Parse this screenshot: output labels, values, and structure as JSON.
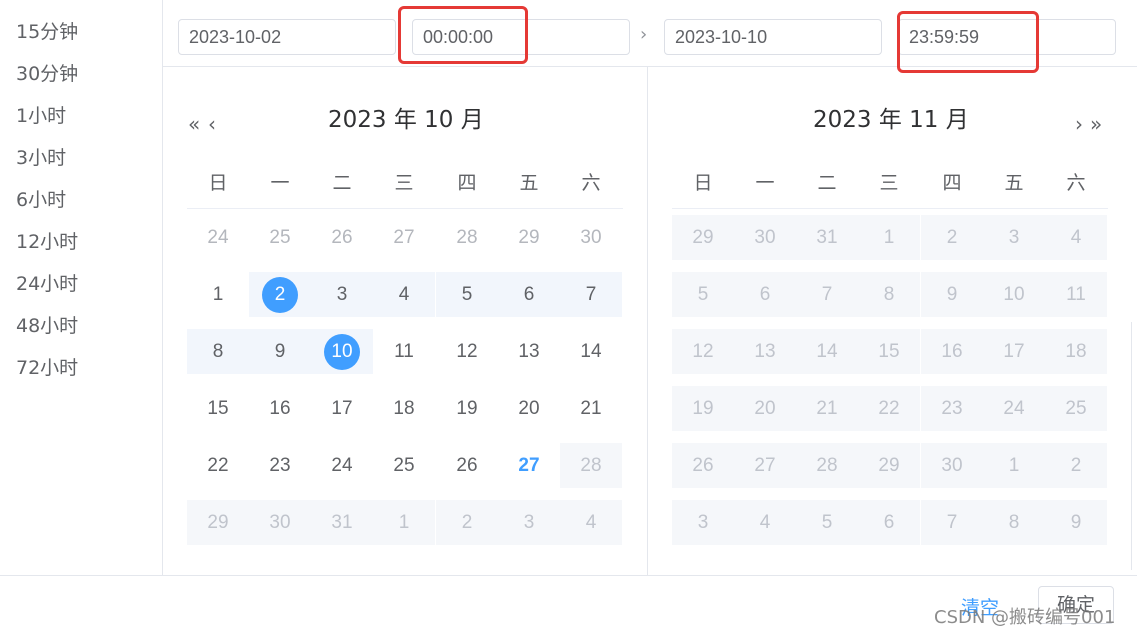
{
  "shortcuts": [
    "15分钟",
    "30分钟",
    "1小时",
    "3小时",
    "6小时",
    "12小时",
    "24小时",
    "48小时",
    "72小时"
  ],
  "header": {
    "start_date": "2023-10-02",
    "start_time": "00:00:00",
    "separator": "›",
    "end_date": "2023-10-10",
    "end_time": "23:59:59"
  },
  "left_panel": {
    "title": "2023 年 10 月",
    "prev_year": "«",
    "prev_month": "‹",
    "weekdays": [
      "日",
      "一",
      "二",
      "三",
      "四",
      "五",
      "六"
    ],
    "rows": [
      [
        {
          "d": "24",
          "s": "muted"
        },
        {
          "d": "25",
          "s": "muted"
        },
        {
          "d": "26",
          "s": "muted"
        },
        {
          "d": "27",
          "s": "muted"
        },
        {
          "d": "28",
          "s": "muted"
        },
        {
          "d": "29",
          "s": "muted"
        },
        {
          "d": "30",
          "s": "muted"
        }
      ],
      [
        {
          "d": "1",
          "s": ""
        },
        {
          "d": "2",
          "s": "start"
        },
        {
          "d": "3",
          "s": "range"
        },
        {
          "d": "4",
          "s": "range"
        },
        {
          "d": "5",
          "s": "range"
        },
        {
          "d": "6",
          "s": "range"
        },
        {
          "d": "7",
          "s": "range"
        }
      ],
      [
        {
          "d": "8",
          "s": "range"
        },
        {
          "d": "9",
          "s": "range"
        },
        {
          "d": "10",
          "s": "end"
        },
        {
          "d": "11",
          "s": ""
        },
        {
          "d": "12",
          "s": ""
        },
        {
          "d": "13",
          "s": ""
        },
        {
          "d": "14",
          "s": ""
        }
      ],
      [
        {
          "d": "15",
          "s": ""
        },
        {
          "d": "16",
          "s": ""
        },
        {
          "d": "17",
          "s": ""
        },
        {
          "d": "18",
          "s": ""
        },
        {
          "d": "19",
          "s": ""
        },
        {
          "d": "20",
          "s": ""
        },
        {
          "d": "21",
          "s": ""
        }
      ],
      [
        {
          "d": "22",
          "s": ""
        },
        {
          "d": "23",
          "s": ""
        },
        {
          "d": "24",
          "s": ""
        },
        {
          "d": "25",
          "s": ""
        },
        {
          "d": "26",
          "s": ""
        },
        {
          "d": "27",
          "s": "today"
        },
        {
          "d": "28",
          "s": "disabled"
        }
      ],
      [
        {
          "d": "29",
          "s": "disabled"
        },
        {
          "d": "30",
          "s": "disabled"
        },
        {
          "d": "31",
          "s": "disabled"
        },
        {
          "d": "1",
          "s": "disabled"
        },
        {
          "d": "2",
          "s": "disabled"
        },
        {
          "d": "3",
          "s": "disabled"
        },
        {
          "d": "4",
          "s": "disabled"
        }
      ]
    ]
  },
  "right_panel": {
    "title": "2023 年 11 月",
    "next_month": "›",
    "next_year": "»",
    "weekdays": [
      "日",
      "一",
      "二",
      "三",
      "四",
      "五",
      "六"
    ],
    "rows": [
      [
        {
          "d": "29",
          "s": "disabled"
        },
        {
          "d": "30",
          "s": "disabled"
        },
        {
          "d": "31",
          "s": "disabled"
        },
        {
          "d": "1",
          "s": "disabled"
        },
        {
          "d": "2",
          "s": "disabled"
        },
        {
          "d": "3",
          "s": "disabled"
        },
        {
          "d": "4",
          "s": "disabled"
        }
      ],
      [
        {
          "d": "5",
          "s": "disabled"
        },
        {
          "d": "6",
          "s": "disabled"
        },
        {
          "d": "7",
          "s": "disabled"
        },
        {
          "d": "8",
          "s": "disabled"
        },
        {
          "d": "9",
          "s": "disabled"
        },
        {
          "d": "10",
          "s": "disabled"
        },
        {
          "d": "11",
          "s": "disabled"
        }
      ],
      [
        {
          "d": "12",
          "s": "disabled"
        },
        {
          "d": "13",
          "s": "disabled"
        },
        {
          "d": "14",
          "s": "disabled"
        },
        {
          "d": "15",
          "s": "disabled"
        },
        {
          "d": "16",
          "s": "disabled"
        },
        {
          "d": "17",
          "s": "disabled"
        },
        {
          "d": "18",
          "s": "disabled"
        }
      ],
      [
        {
          "d": "19",
          "s": "disabled"
        },
        {
          "d": "20",
          "s": "disabled"
        },
        {
          "d": "21",
          "s": "disabled"
        },
        {
          "d": "22",
          "s": "disabled"
        },
        {
          "d": "23",
          "s": "disabled"
        },
        {
          "d": "24",
          "s": "disabled"
        },
        {
          "d": "25",
          "s": "disabled"
        }
      ],
      [
        {
          "d": "26",
          "s": "disabled"
        },
        {
          "d": "27",
          "s": "disabled"
        },
        {
          "d": "28",
          "s": "disabled"
        },
        {
          "d": "29",
          "s": "disabled"
        },
        {
          "d": "30",
          "s": "disabled"
        },
        {
          "d": "1",
          "s": "disabled"
        },
        {
          "d": "2",
          "s": "disabled"
        }
      ],
      [
        {
          "d": "3",
          "s": "disabled"
        },
        {
          "d": "4",
          "s": "disabled"
        },
        {
          "d": "5",
          "s": "disabled"
        },
        {
          "d": "6",
          "s": "disabled"
        },
        {
          "d": "7",
          "s": "disabled"
        },
        {
          "d": "8",
          "s": "disabled"
        },
        {
          "d": "9",
          "s": "disabled"
        }
      ]
    ]
  },
  "footer": {
    "clear_label": "清空",
    "ok_label": "确定",
    "watermark": "CSDN @搬砖编号001"
  },
  "colors": {
    "accent": "#409eff",
    "highlight_box": "#e53935",
    "range_bg": "#f2f6fc",
    "disabled_bg": "#f5f7fa"
  }
}
